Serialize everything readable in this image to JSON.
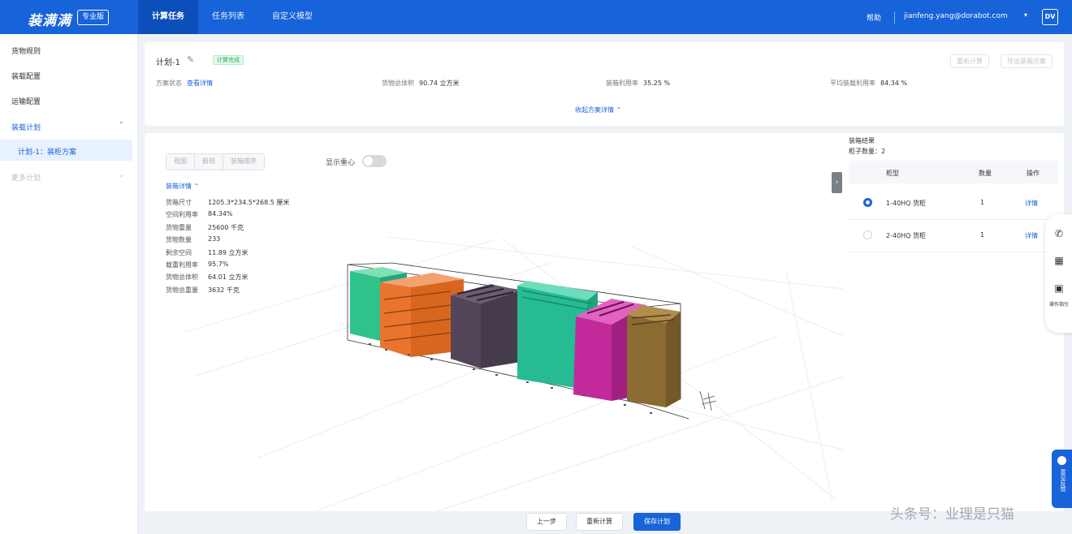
{
  "topbar": {
    "logo": "装满满",
    "edition": "专业版",
    "nav": [
      "计算任务",
      "任务列表",
      "自定义模型"
    ],
    "help": "帮助",
    "email": "jianfeng.yang@dorabot.com",
    "avatar": "DV"
  },
  "sidebar": {
    "items": [
      "货物规则",
      "装载配置",
      "运输配置"
    ],
    "plan_group": "装载计划",
    "sub_item": "计划-1：装柜方案",
    "more": "更多计划"
  },
  "header": {
    "plan_title": "计划-1",
    "status": "计算完成",
    "btn_primary": "重新计算",
    "btn_secondary": "导出装箱方案",
    "meta": [
      {
        "label": "方案状态",
        "value": "查看详情"
      },
      {
        "label": "货物总体积",
        "value": "90.74 立方米"
      },
      {
        "label": "装箱利用率",
        "value": "35.25 %"
      },
      {
        "label": "平均装载利用率",
        "value": "84.34 %"
      }
    ],
    "expand_label": "收起方案详情"
  },
  "viewer": {
    "views": [
      "视图",
      "俯视",
      "装箱顺序"
    ],
    "toggle_label": "显示重心",
    "info_title": "装箱详情",
    "info": [
      {
        "k": "货箱尺寸",
        "v": "1205.3*234.5*268.5 厘米"
      },
      {
        "k": "空间利用率",
        "v": "84.34%"
      },
      {
        "k": "货物重量",
        "v": "25600 千克"
      },
      {
        "k": "货物数量",
        "v": "233"
      },
      {
        "k": "剩余空间",
        "v": "11.89 立方米"
      },
      {
        "k": "载重利用率",
        "v": "95.7%"
      },
      {
        "k": "货物总体积",
        "v": "64.01 立方米"
      },
      {
        "k": "货物总重量",
        "v": "3632 千克"
      }
    ],
    "collapse": "›",
    "boxes": [
      {
        "color": "#2fc28a"
      },
      {
        "color": "#e8742f"
      },
      {
        "color": "#524558"
      },
      {
        "color": "#26bb93"
      },
      {
        "color": "#c22a9b"
      },
      {
        "color": "#8b6b32"
      }
    ]
  },
  "results": {
    "title": "装箱结果",
    "count_label": "柜子数量：2",
    "columns": [
      "柜型",
      "数量",
      "操作"
    ],
    "rows": [
      {
        "name": "1-40HQ 货柜",
        "qty": "1",
        "action": "详情",
        "selected": true
      },
      {
        "name": "2-40HQ 货柜",
        "qty": "1",
        "action": "详情",
        "selected": false
      }
    ]
  },
  "footer": {
    "prev": "上一步",
    "recalc": "重新计算",
    "save": "保存计划"
  },
  "tools": {
    "label": "操作指引",
    "feedback": "意见反馈"
  },
  "watermark": "头条号：业理是只猫",
  "colors": {
    "primary": "#1763d9",
    "success": "#27a85a"
  }
}
